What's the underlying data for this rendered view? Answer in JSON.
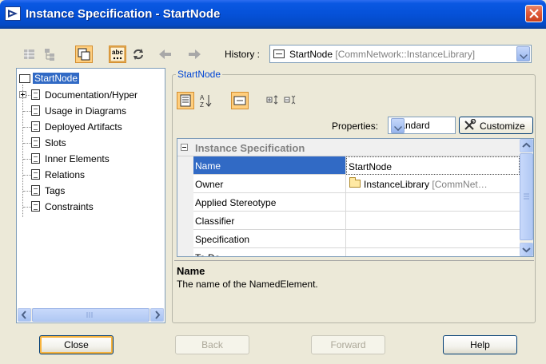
{
  "window": {
    "title": "Instance Specification - StartNode",
    "title_icon": "diagram-icon",
    "close_icon": "close-icon"
  },
  "toolbar": {
    "icons": [
      "grid-icon",
      "tree-icon",
      "copy-icon",
      "spell-check-icon",
      "refresh-icon",
      "back-arrow-icon",
      "forward-arrow-icon"
    ],
    "spell_check_label": "abc",
    "history_label": "History :",
    "history_value": "StartNode",
    "history_qualifier": "[CommNetwork::InstanceLibrary]"
  },
  "tree": {
    "root": "StartNode",
    "items": [
      "Documentation/Hyper",
      "Usage in Diagrams",
      "Deployed Artifacts",
      "Slots",
      "Inner Elements",
      "Relations",
      "Tags",
      "Constraints"
    ]
  },
  "properties": {
    "group_title": "StartNode",
    "toolbar_icons": [
      "categorized-icon",
      "sort-alpha-icon",
      "element-icon",
      "expand-all-icon",
      "collapse-all-icon"
    ],
    "properties_label": "Properties:",
    "properties_value": "Standard",
    "customize_label": "Customize",
    "section_title": "Instance Specification",
    "rows": [
      {
        "key": "Name",
        "value": "StartNode",
        "qualifier": ""
      },
      {
        "key": "Owner",
        "value": "InstanceLibrary",
        "qualifier": "[CommNet…"
      },
      {
        "key": "Applied Stereotype",
        "value": "",
        "qualifier": ""
      },
      {
        "key": "Classifier",
        "value": "",
        "qualifier": ""
      },
      {
        "key": "Specification",
        "value": "",
        "qualifier": ""
      },
      {
        "key": "To Do",
        "value": "",
        "qualifier": ""
      }
    ]
  },
  "description": {
    "title": "Name",
    "text": "The name of the NamedElement."
  },
  "buttons": {
    "close": "Close",
    "back": "Back",
    "forward": "Forward",
    "help": "Help"
  },
  "colors": {
    "titlebar": "#0551d8",
    "selection": "#316ac5",
    "toggle_active": "#ffce7d",
    "dialog_bg": "#ece9d8"
  }
}
